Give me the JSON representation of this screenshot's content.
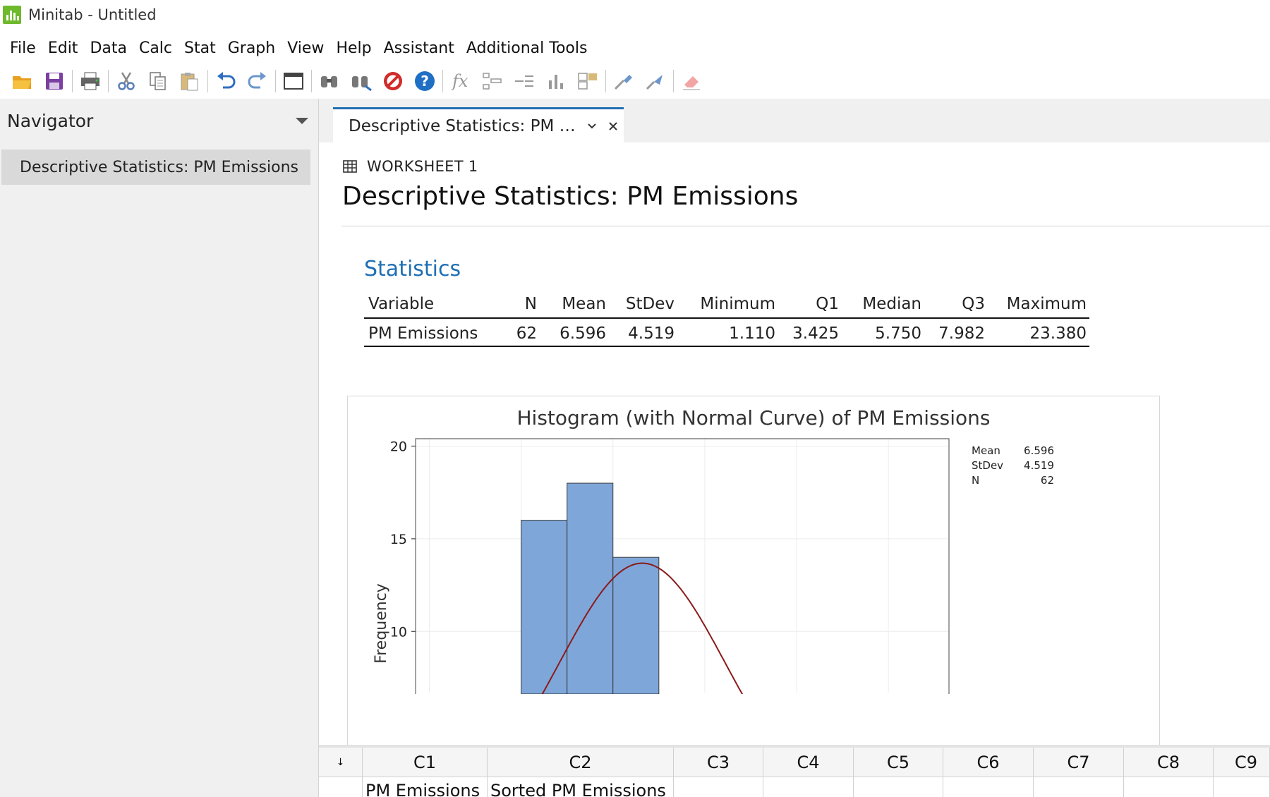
{
  "window": {
    "title": "Minitab - Untitled"
  },
  "menu": [
    "File",
    "Edit",
    "Data",
    "Calc",
    "Stat",
    "Graph",
    "View",
    "Help",
    "Assistant",
    "Additional Tools"
  ],
  "toolbar": {
    "icons": [
      "open-icon",
      "save-icon",
      "print-icon",
      "cut-icon",
      "copy-icon",
      "paste-icon",
      "undo-icon",
      "redo-icon",
      "window-icon",
      "find-icon",
      "find-replace-icon",
      "cancel-icon",
      "help-icon",
      "formula-icon",
      "tree-icon",
      "branch-icon",
      "bar-icon",
      "arrange-icon",
      "brush-icon",
      "select-icon",
      "eraser-icon"
    ]
  },
  "navigator": {
    "title": "Navigator",
    "items": [
      {
        "label": "Descriptive Statistics: PM Emissions"
      }
    ]
  },
  "tab": {
    "label": "Descriptive Statistics: PM E..."
  },
  "output": {
    "worksheet_label": "WORKSHEET 1",
    "title": "Descriptive Statistics: PM Emissions",
    "section": "Statistics",
    "table": {
      "headers": [
        "Variable",
        "N",
        "Mean",
        "StDev",
        "Minimum",
        "Q1",
        "Median",
        "Q3",
        "Maximum"
      ],
      "rows": [
        [
          "PM Emissions",
          "62",
          "6.596",
          "4.519",
          "1.110",
          "3.425",
          "5.750",
          "7.982",
          "23.380"
        ]
      ]
    }
  },
  "chart_data": {
    "type": "bar",
    "title": "Histogram (with Normal Curve) of PM Emissions",
    "ylabel": "Frequency",
    "xlabel": "",
    "yticks": [
      10,
      15,
      20
    ],
    "y_visible_range": [
      6.7,
      20.4
    ],
    "bins": [
      {
        "start": 0,
        "end": 2.5,
        "count": 16
      },
      {
        "start": 2.5,
        "end": 5,
        "count": 18
      },
      {
        "start": 5,
        "end": 7.5,
        "count": 14
      }
    ],
    "x_visible_range": [
      -5.75,
      23.3
    ],
    "normal_curve": {
      "mean": 6.596,
      "stdev": 4.519,
      "n": 62,
      "bin_width": 2.5
    },
    "legend": {
      "position": "top-right",
      "entries": [
        [
          "Mean",
          "6.596"
        ],
        [
          "StDev",
          "4.519"
        ],
        [
          "N",
          "62"
        ]
      ]
    },
    "colors": {
      "bar": "#7ea6d9",
      "bar_edge": "#3a3a3a",
      "curve": "#8b1a1a"
    }
  },
  "worksheet": {
    "columns": [
      "C1",
      "C2",
      "C3",
      "C4",
      "C5",
      "C6",
      "C7",
      "C8",
      "C9"
    ],
    "names": [
      "PM Emissions",
      "Sorted PM Emissions",
      "",
      "",
      "",
      "",
      "",
      "",
      ""
    ]
  }
}
